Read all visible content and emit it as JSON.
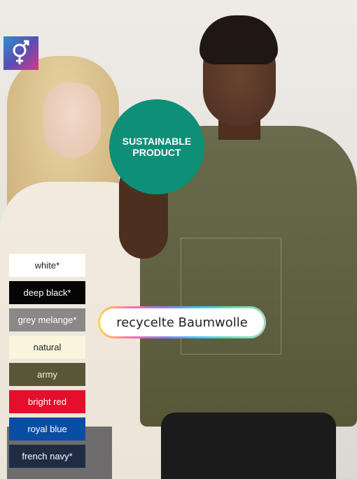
{
  "badges": {
    "gender_icon": "male-female-symbol",
    "sustainable_line1": "SUSTAINABLE",
    "sustainable_line2": "PRODUCT",
    "recycled": "recycelte Baumwolle"
  },
  "colors": {
    "accent_teal": "#0e8f78"
  },
  "swatches": [
    {
      "label": "white*",
      "color": "#ffffff"
    },
    {
      "label": "deep black*",
      "color": "#050505"
    },
    {
      "label": "grey melange*",
      "color": "#8a8888"
    },
    {
      "label": "natural",
      "color": "#fbf5dd"
    },
    {
      "label": "army",
      "color": "#575637"
    },
    {
      "label": "bright red",
      "color": "#e3102b"
    },
    {
      "label": "royal blue",
      "color": "#0a4ea3"
    },
    {
      "label": "french navy*",
      "color": "#1f2c44"
    }
  ]
}
